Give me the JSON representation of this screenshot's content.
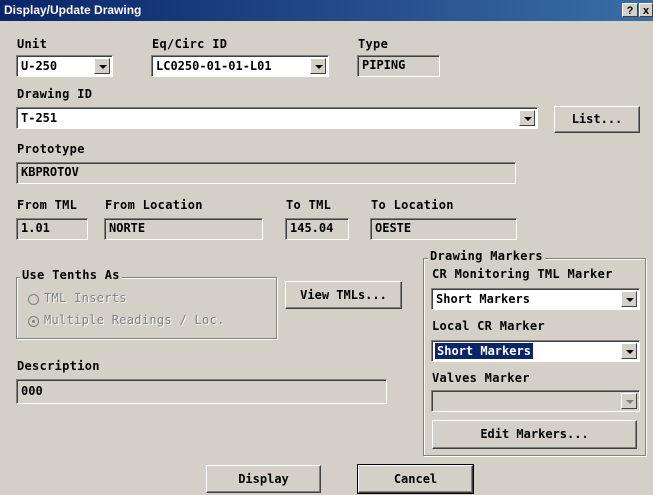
{
  "window": {
    "title": "Display/Update Drawing",
    "help_btn": "?",
    "close_btn": "x"
  },
  "unit": {
    "label": "Unit",
    "value": "U-250"
  },
  "eqcirc": {
    "label": "Eq/Circ ID",
    "value": "LC0250-01-01-L01"
  },
  "type": {
    "label": "Type",
    "value": "PIPING"
  },
  "drawing": {
    "label": "Drawing ID",
    "value": "T-251",
    "list_btn": "List..."
  },
  "prototype": {
    "label": "Prototype",
    "value": "KBPROTOV"
  },
  "from_tml": {
    "label": "From TML",
    "value": "1.01"
  },
  "from_location": {
    "label": "From Location",
    "value": "NORTE"
  },
  "to_tml": {
    "label": "To TML",
    "value": "145.04"
  },
  "to_location": {
    "label": "To Location",
    "value": "OESTE"
  },
  "tenths": {
    "legend": "Use Tenths As",
    "options": [
      "TML Inserts",
      "Multiple Readings / Loc."
    ],
    "selected": "Multiple Readings / Loc."
  },
  "view_tmls_btn": "View TMLs...",
  "description": {
    "label": "Description",
    "value": "000"
  },
  "markers": {
    "legend": "Drawing Markers",
    "cr_monitoring": {
      "label": "CR Monitoring TML Marker",
      "value": "Short Markers"
    },
    "local_cr": {
      "label": "Local CR Marker",
      "value": "Short Markers"
    },
    "valves": {
      "label": "Valves Marker",
      "value": ""
    },
    "edit_btn": "Edit Markers..."
  },
  "buttons": {
    "display": "Display",
    "cancel": "Cancel"
  }
}
